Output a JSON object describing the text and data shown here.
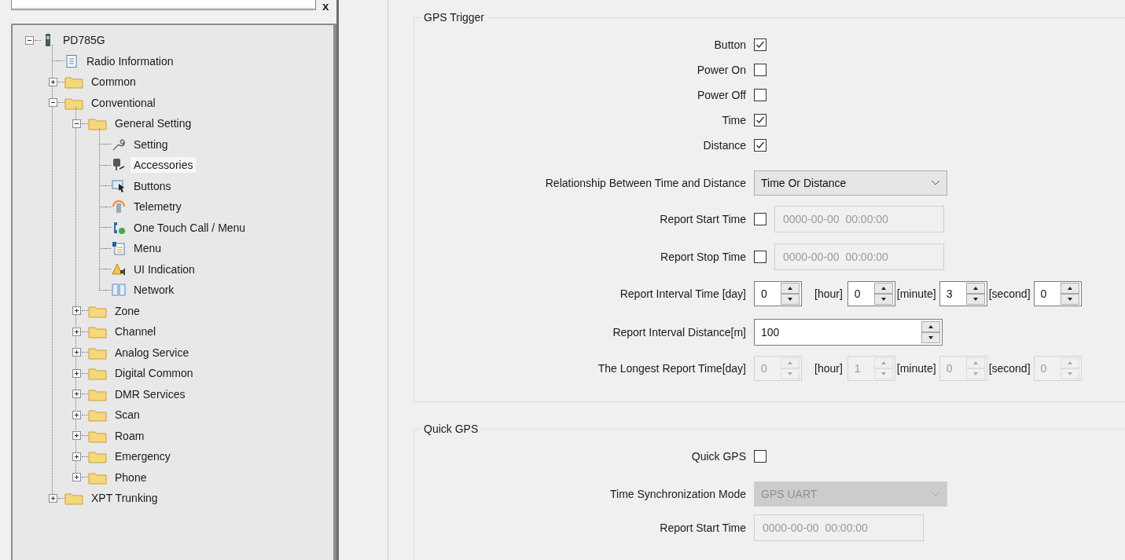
{
  "tree": {
    "close": "x",
    "nodes": [
      {
        "label": "PD785G",
        "kind": "device",
        "expanded": true,
        "selected": false,
        "children": [
          {
            "label": "Radio Information",
            "kind": "document",
            "selected": false
          },
          {
            "label": "Common",
            "kind": "folder",
            "expanded": false,
            "selected": false
          },
          {
            "label": "Conventional",
            "kind": "folder",
            "expanded": true,
            "selected": false,
            "children": [
              {
                "label": "General Setting",
                "kind": "folder",
                "expanded": true,
                "selected": false,
                "children": [
                  {
                    "label": "Setting",
                    "kind": "wrench",
                    "selected": false
                  },
                  {
                    "label": "Accessories",
                    "kind": "accessory",
                    "selected": true
                  },
                  {
                    "label": "Buttons",
                    "kind": "cursor",
                    "selected": false
                  },
                  {
                    "label": "Telemetry",
                    "kind": "telemetry",
                    "selected": false
                  },
                  {
                    "label": "One Touch Call / Menu",
                    "kind": "call",
                    "selected": false
                  },
                  {
                    "label": "Menu",
                    "kind": "menu",
                    "selected": false
                  },
                  {
                    "label": "UI Indication",
                    "kind": "warning",
                    "selected": false
                  },
                  {
                    "label": "Network",
                    "kind": "network",
                    "selected": false
                  }
                ]
              },
              {
                "label": "Zone",
                "kind": "folder",
                "expanded": false,
                "selected": false
              },
              {
                "label": "Channel",
                "kind": "folder",
                "expanded": false,
                "selected": false
              },
              {
                "label": "Analog Service",
                "kind": "folder",
                "expanded": false,
                "selected": false
              },
              {
                "label": "Digital Common",
                "kind": "folder",
                "expanded": false,
                "selected": false
              },
              {
                "label": "DMR Services",
                "kind": "folder",
                "expanded": false,
                "selected": false
              },
              {
                "label": "Scan",
                "kind": "folder",
                "expanded": false,
                "selected": false
              },
              {
                "label": "Roam",
                "kind": "folder",
                "expanded": false,
                "selected": false
              },
              {
                "label": "Emergency",
                "kind": "folder",
                "expanded": false,
                "selected": false
              },
              {
                "label": "Phone",
                "kind": "folder",
                "expanded": false,
                "selected": false
              }
            ]
          },
          {
            "label": "XPT Trunking",
            "kind": "folder",
            "expanded": false,
            "selected": false
          }
        ]
      }
    ]
  },
  "groups": [
    {
      "title": "GPS Trigger",
      "rows": [
        {
          "kind": "checkbox",
          "label": "Button",
          "checked": true
        },
        {
          "kind": "checkbox",
          "label": "Power On",
          "checked": false
        },
        {
          "kind": "checkbox",
          "label": "Power Off",
          "checked": false
        },
        {
          "kind": "checkbox",
          "label": "Time",
          "checked": true
        },
        {
          "kind": "checkbox",
          "label": "Distance",
          "checked": true
        },
        {
          "kind": "select",
          "label": "Relationship Between Time and Distance",
          "value": "Time Or Distance",
          "disabled": false
        },
        {
          "kind": "datetime",
          "label": "Report Start Time",
          "checked": false,
          "value": "0000-00-00  00:00:00",
          "disabled": true
        },
        {
          "kind": "datetime",
          "label": "Report Stop Time",
          "checked": false,
          "value": "0000-00-00  00:00:00",
          "disabled": true
        },
        {
          "kind": "spins",
          "label": "Report Interval Time [day]",
          "disabled": false,
          "spinners": [
            {
              "value": "0"
            },
            {
              "unit": "[hour]",
              "value": "0"
            },
            {
              "unit": "[minute]",
              "value": "3"
            },
            {
              "unit": "[second]",
              "value": "0"
            }
          ]
        },
        {
          "kind": "number",
          "label": "Report Interval Distance[m]",
          "value": "100",
          "disabled": false
        },
        {
          "kind": "spins",
          "label": "The Longest Report Time[day]",
          "disabled": true,
          "spinners": [
            {
              "value": "0"
            },
            {
              "unit": "[hour]",
              "value": "1"
            },
            {
              "unit": "[minute]",
              "value": "0"
            },
            {
              "unit": "[second]",
              "value": "0"
            }
          ]
        }
      ]
    },
    {
      "title": "Quick GPS",
      "rows": [
        {
          "kind": "checkbox",
          "label": "Quick GPS",
          "checked": false
        },
        {
          "kind": "select",
          "label": "Time Synchronization Mode",
          "value": "GPS UART",
          "disabled": true
        },
        {
          "kind": "field",
          "label": "Report Start Time",
          "value": "0000-00-00  00:00:00",
          "disabled": true
        }
      ]
    }
  ]
}
